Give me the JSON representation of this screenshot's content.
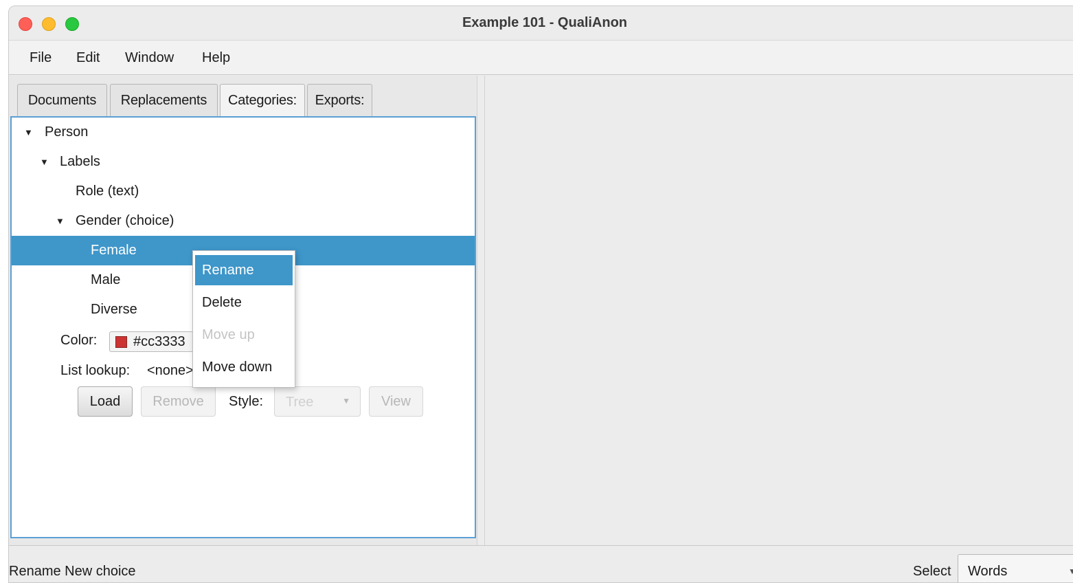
{
  "window": {
    "title": "Example 101 - QualiAnon"
  },
  "menubar": {
    "items": [
      "File",
      "Edit",
      "Window",
      "Help"
    ]
  },
  "tabs": [
    {
      "label": "Documents",
      "active": false
    },
    {
      "label": "Replacements",
      "active": false
    },
    {
      "label": "Categories:",
      "active": true
    },
    {
      "label": "Exports:",
      "active": false
    }
  ],
  "tree": {
    "nodes": [
      {
        "label": "Person",
        "expanded": true
      },
      {
        "label": "Labels",
        "expanded": true
      },
      {
        "label": "Role (text)"
      },
      {
        "label": "Gender (choice)",
        "expanded": true
      },
      {
        "label": "Female",
        "selected": true
      },
      {
        "label": "Male"
      },
      {
        "label": "Diverse"
      }
    ]
  },
  "properties": {
    "color_label": "Color:",
    "color_value": "#cc3333",
    "list_lookup_label": "List lookup:",
    "list_lookup_value": "<none>",
    "load_button": "Load",
    "remove_button": "Remove",
    "style_label": "Style:",
    "style_value": "Tree",
    "view_button": "View"
  },
  "context_menu": {
    "items": [
      {
        "label": "Rename",
        "highlighted": true,
        "enabled": true
      },
      {
        "label": "Delete",
        "enabled": true
      },
      {
        "label": "Move up",
        "enabled": false
      },
      {
        "label": "Move down",
        "enabled": true
      }
    ]
  },
  "statusbar": {
    "message": "Rename New choice",
    "select_label": "Select",
    "select_value": "Words"
  },
  "colors": {
    "selection": "#3e96c9",
    "tree_focus_border": "#5a9fd4",
    "swatch": "#cc3333"
  }
}
